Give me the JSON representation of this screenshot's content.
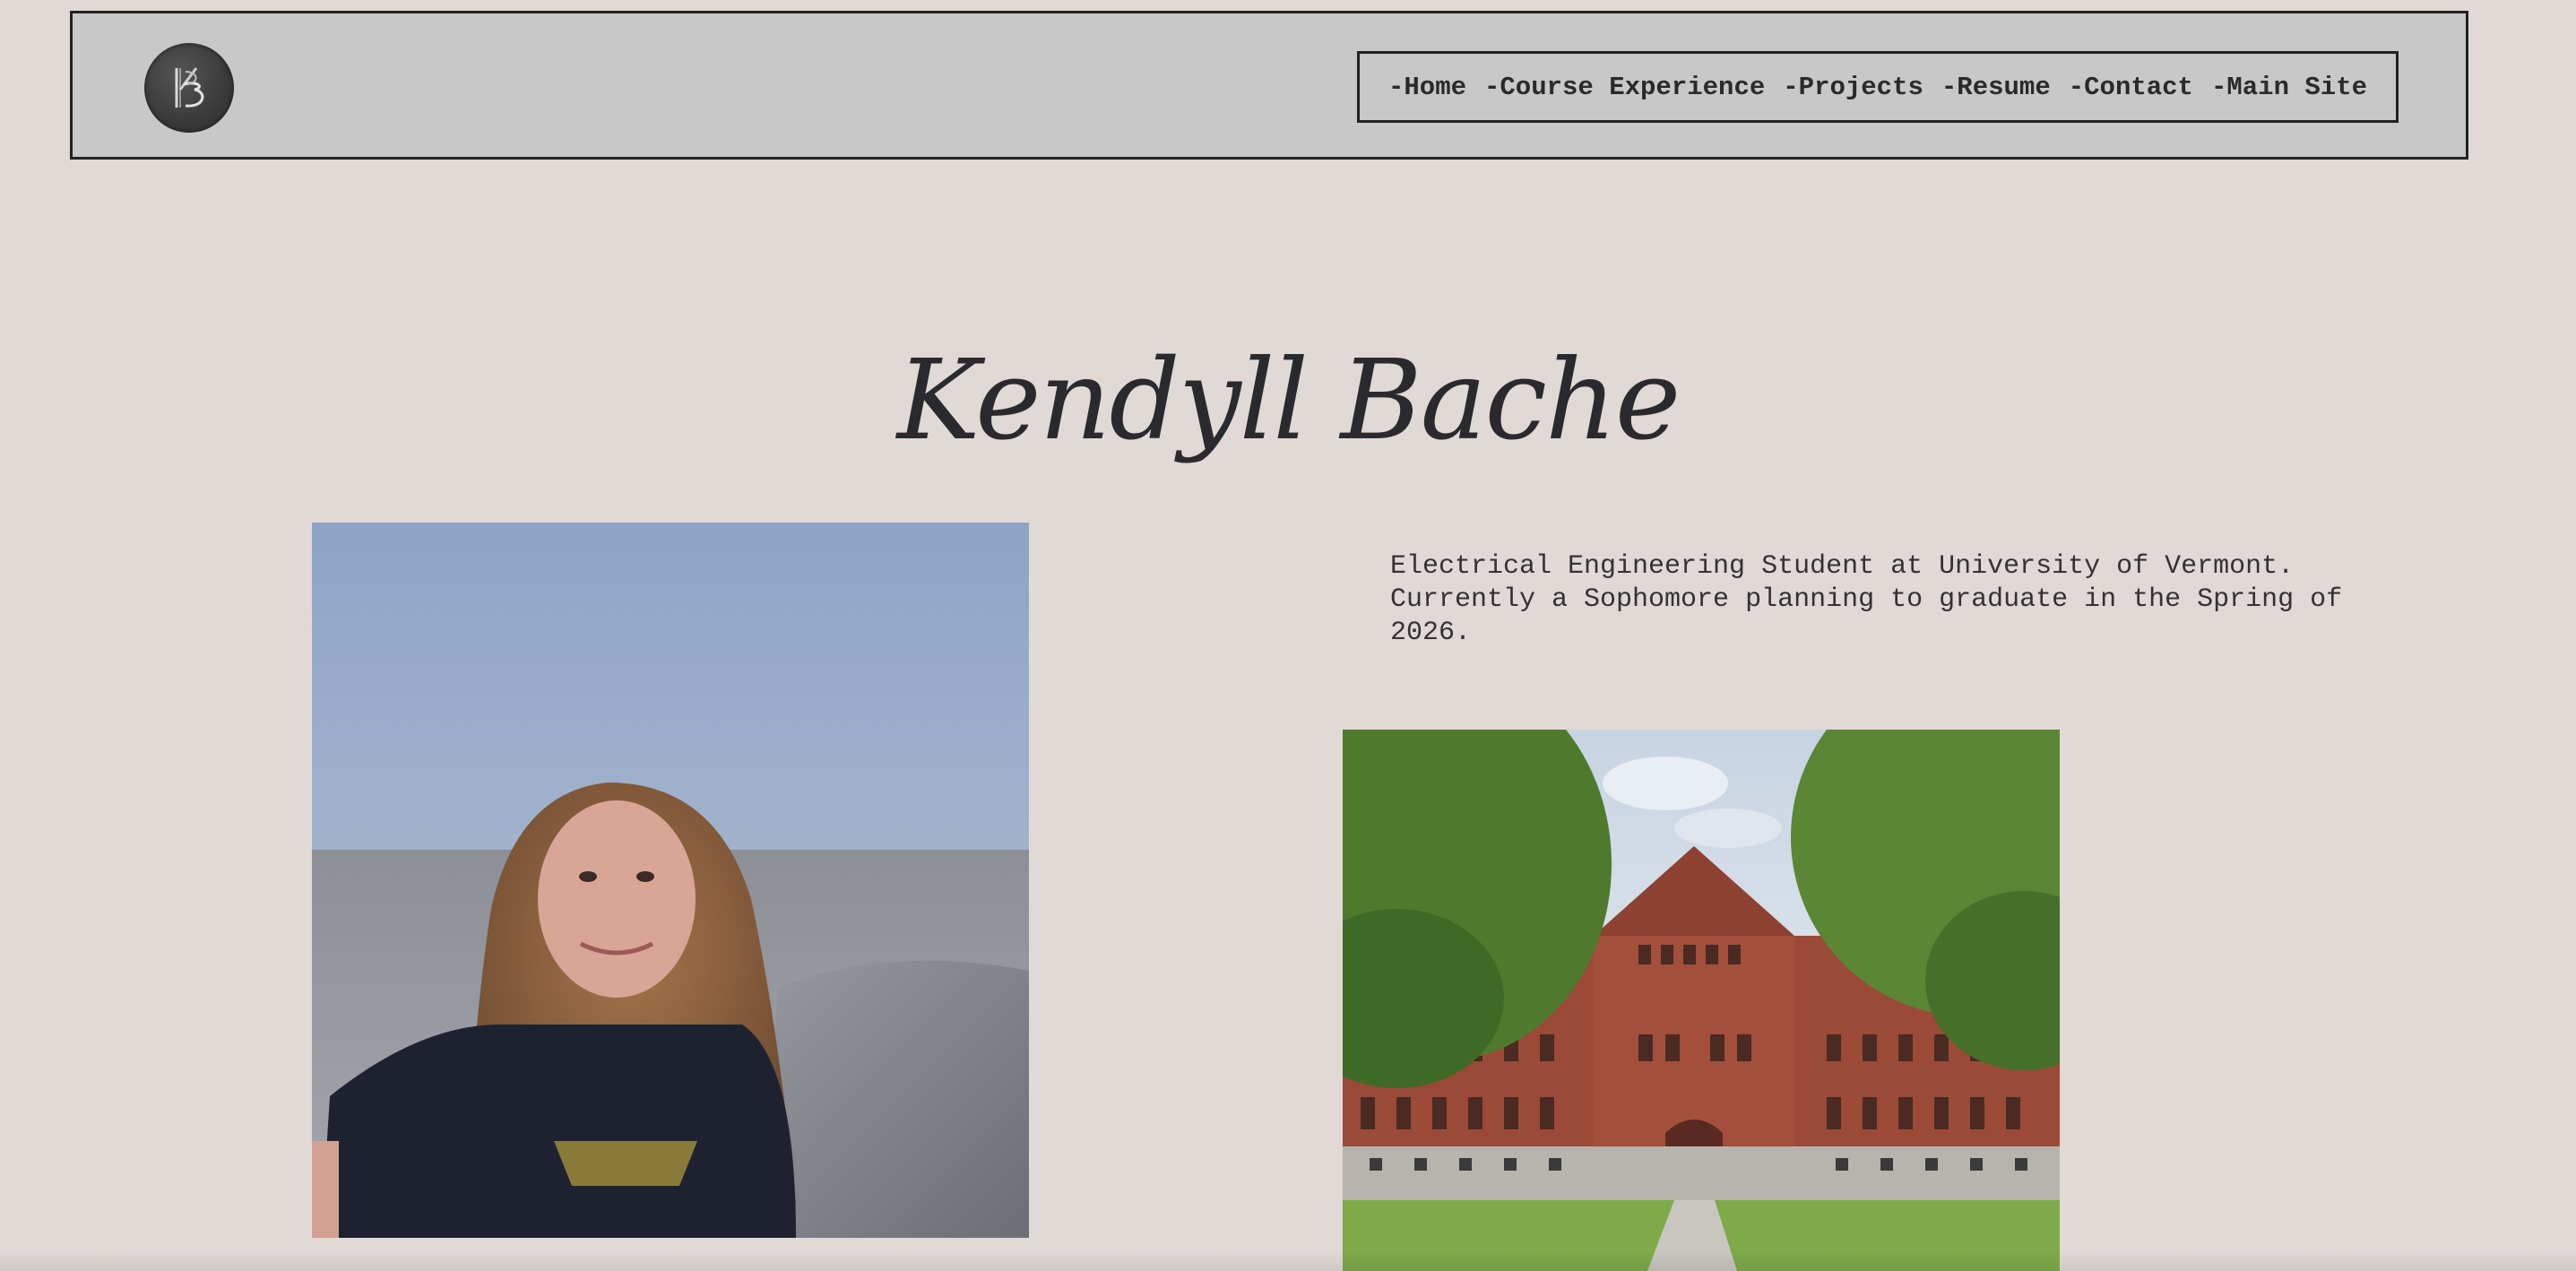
{
  "header": {
    "logo_text": "KB",
    "nav": [
      {
        "label": "-Home"
      },
      {
        "label": "-Course Experience"
      },
      {
        "label": "-Projects"
      },
      {
        "label": "-Resume"
      },
      {
        "label": "-Contact"
      },
      {
        "label": "-Main Site"
      }
    ]
  },
  "main": {
    "title": "Kendyll Bache",
    "description": "Electrical Engineering Student at University of Vermont. Currently a Sophomore planning to graduate in the Spring of 2026."
  },
  "colors": {
    "background": "#e1d9d6",
    "header_background": "#c8c8c8",
    "border": "#222222",
    "text": "#2b2b2b"
  }
}
